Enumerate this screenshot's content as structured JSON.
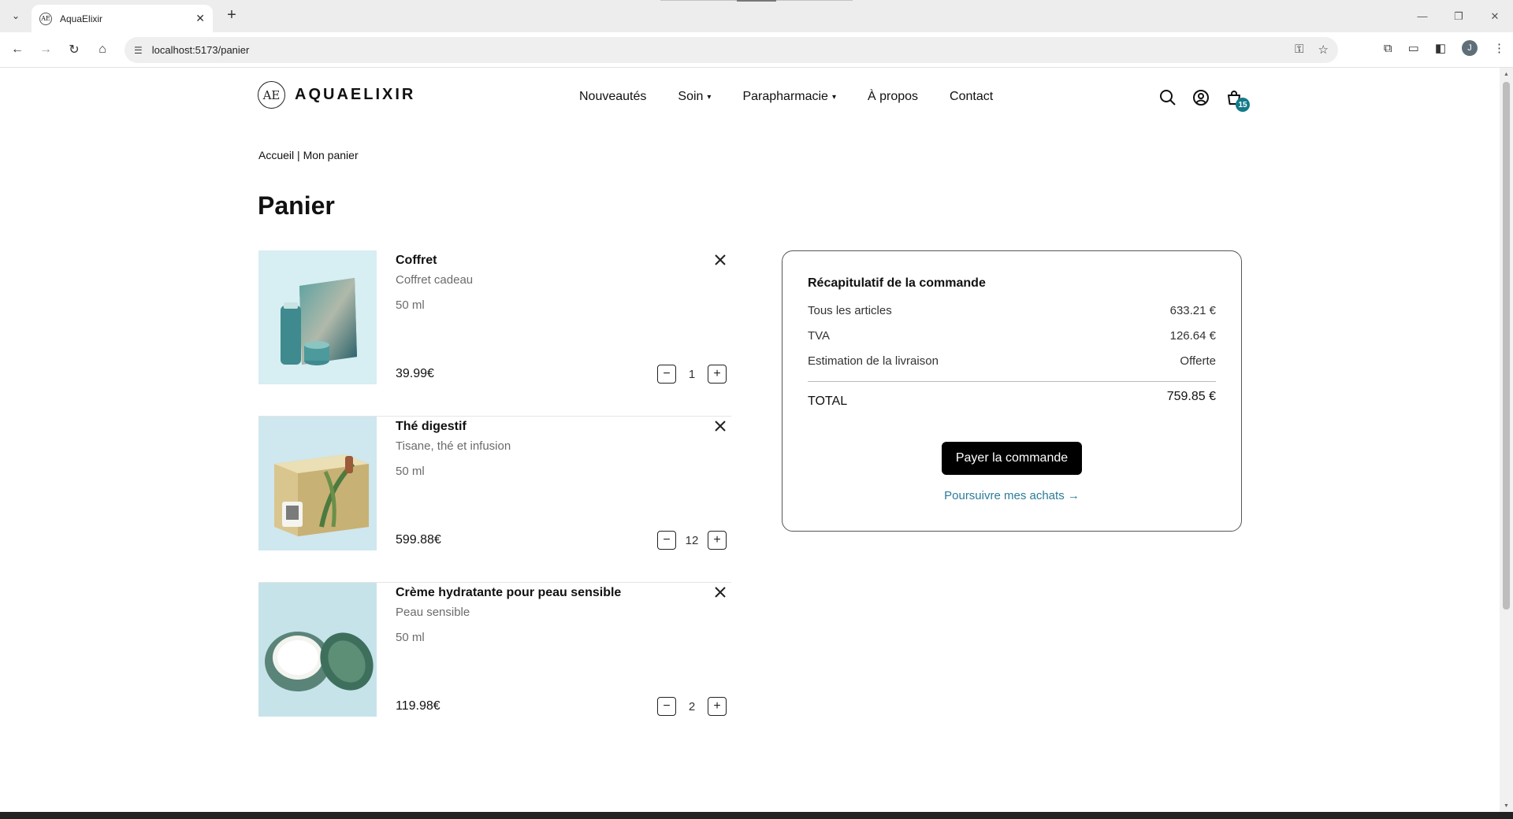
{
  "browser": {
    "tab_title": "AquaElixir",
    "favicon_text": "AE",
    "url": "localhost:5173/panier",
    "profile_initial": "J"
  },
  "header": {
    "logo_mark": "AE",
    "logo_text": "AQUAELIXIR",
    "nav": [
      {
        "label": "Nouveautés"
      },
      {
        "label": "Soin"
      },
      {
        "label": "Parapharmacie"
      },
      {
        "label": "À propos"
      },
      {
        "label": "Contact"
      }
    ],
    "cart_count": "15"
  },
  "breadcrumb": {
    "home": "Accueil",
    "separator": "|",
    "current": "Mon panier"
  },
  "page_title": "Panier",
  "cart": {
    "items": [
      {
        "name": "Coffret",
        "category": "Coffret cadeau",
        "volume": "50 ml",
        "price": "39.99€",
        "quantity": "1"
      },
      {
        "name": "Thé digestif",
        "category": "Tisane, thé et infusion",
        "volume": "50 ml",
        "price": "599.88€",
        "quantity": "12"
      },
      {
        "name": "Crème hydratante pour peau sensible",
        "category": "Peau sensible",
        "volume": "50 ml",
        "price": "119.98€",
        "quantity": "2"
      }
    ]
  },
  "summary": {
    "title": "Récapitulatif de la commande",
    "rows": [
      {
        "label": "Tous les articles",
        "value": "633.21 €"
      },
      {
        "label": "TVA",
        "value": "126.64 €"
      },
      {
        "label": "Estimation de la livraison",
        "value": "Offerte"
      }
    ],
    "total_label": "TOTAL",
    "total_value": "759.85 €",
    "pay_button": "Payer la commande",
    "continue_link": "Poursuivre mes achats →"
  },
  "colors": {
    "accent": "#137a8a",
    "link": "#2b7c99",
    "button": "#000000"
  }
}
